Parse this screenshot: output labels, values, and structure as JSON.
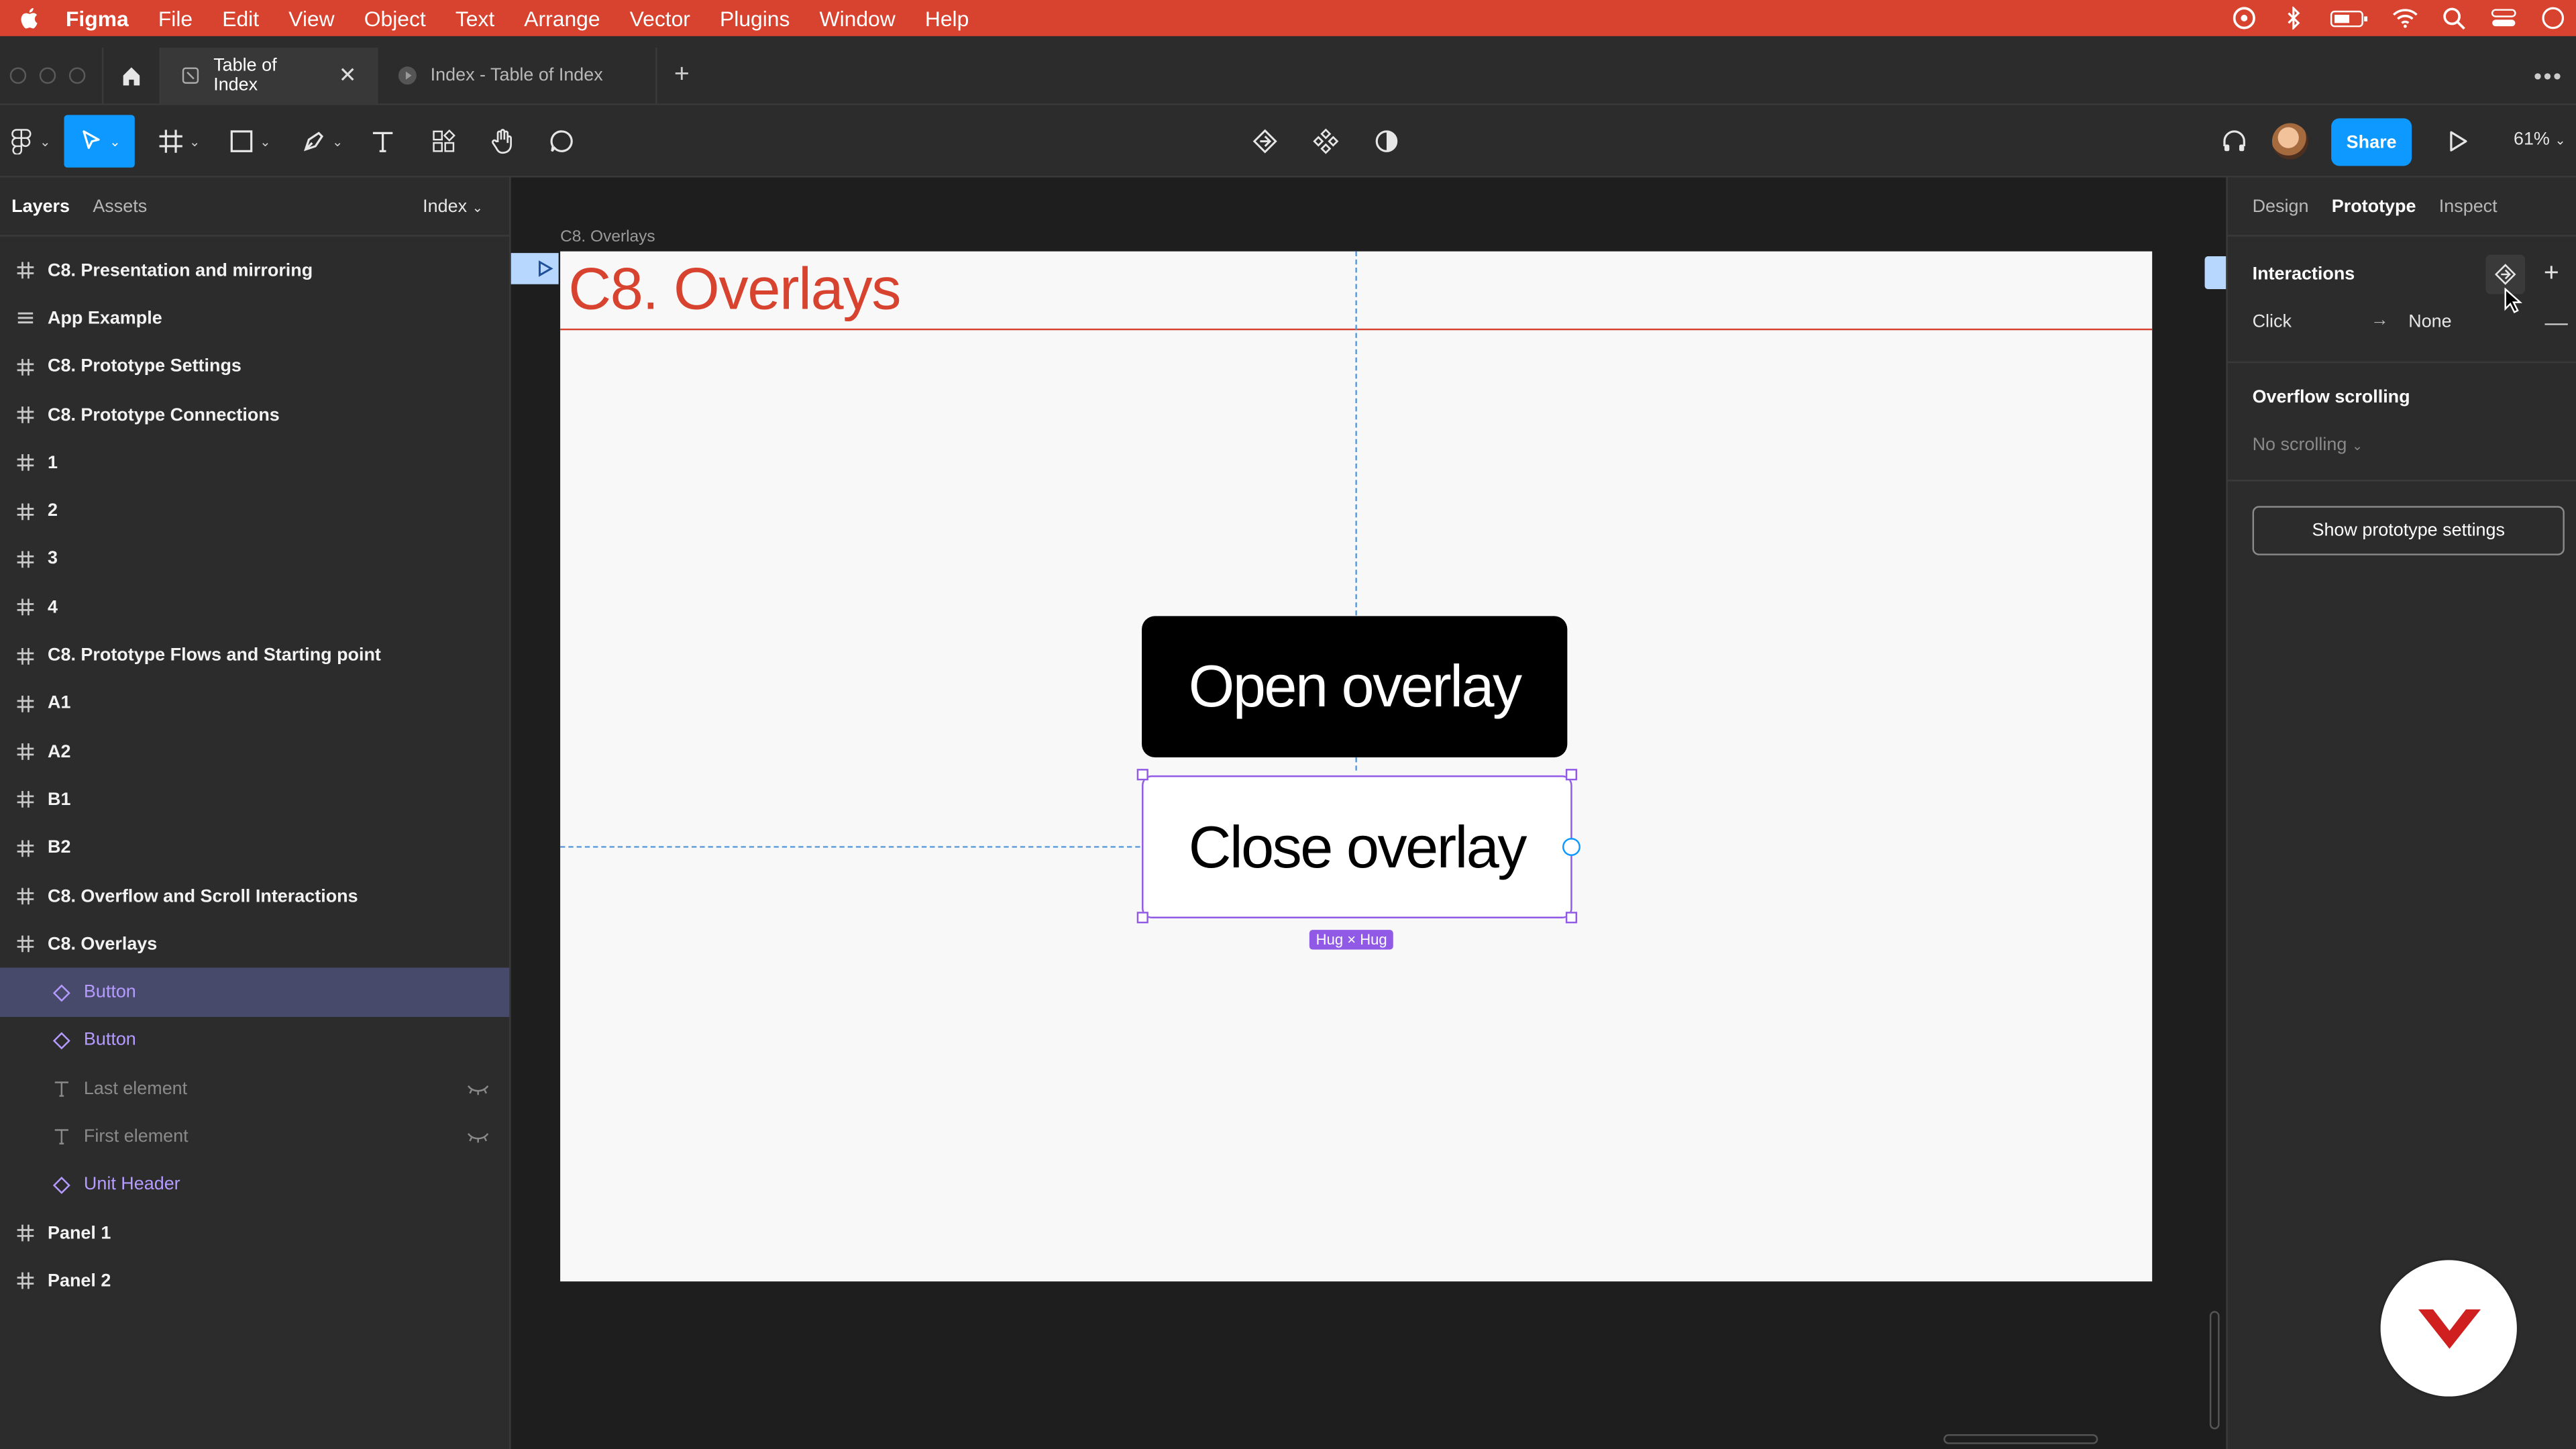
{
  "menubar": {
    "app": "Figma",
    "items": [
      "File",
      "Edit",
      "View",
      "Object",
      "Text",
      "Arrange",
      "Vector",
      "Plugins",
      "Window",
      "Help"
    ]
  },
  "tabs": {
    "active": "Table of Index",
    "inactive": "Index - Table of Index"
  },
  "toolbar": {
    "share_label": "Share",
    "zoom": "61%"
  },
  "left_panel": {
    "tab_layers": "Layers",
    "tab_assets": "Assets",
    "page_selector": "Index",
    "layers": [
      {
        "label": "C8. Presentation and mirroring",
        "kind": "frame"
      },
      {
        "label": "App Example",
        "kind": "list"
      },
      {
        "label": "C8. Prototype Settings",
        "kind": "frame"
      },
      {
        "label": "C8. Prototype Connections",
        "kind": "frame"
      },
      {
        "label": "1",
        "kind": "frame"
      },
      {
        "label": "2",
        "kind": "frame"
      },
      {
        "label": "3",
        "kind": "frame"
      },
      {
        "label": "4",
        "kind": "frame"
      },
      {
        "label": "C8. Prototype Flows and Starting point",
        "kind": "frame"
      },
      {
        "label": "A1",
        "kind": "frame"
      },
      {
        "label": "A2",
        "kind": "frame"
      },
      {
        "label": "B1",
        "kind": "frame"
      },
      {
        "label": "B2",
        "kind": "frame"
      },
      {
        "label": "C8. Overflow and Scroll Interactions",
        "kind": "frame"
      },
      {
        "label": "C8. Overlays",
        "kind": "frame"
      },
      {
        "label": "Button",
        "kind": "component-child",
        "selected": true
      },
      {
        "label": "Button",
        "kind": "component-child"
      },
      {
        "label": "Last element",
        "kind": "text-child",
        "hidden": true
      },
      {
        "label": "First element",
        "kind": "text-child",
        "hidden": true
      },
      {
        "label": "Unit Header",
        "kind": "component-child"
      },
      {
        "label": "Panel 1",
        "kind": "frame"
      },
      {
        "label": "Panel 2",
        "kind": "frame"
      }
    ]
  },
  "canvas": {
    "frame_label": "C8. Overlays",
    "frame_title": "C8.  Overlays",
    "open_button": "Open overlay",
    "close_button": "Close overlay",
    "size_badge": "Hug × Hug"
  },
  "right_panel": {
    "tabs": [
      "Design",
      "Prototype",
      "Inspect"
    ],
    "interactions_title": "Interactions",
    "interaction": {
      "trigger": "Click",
      "action": "None"
    },
    "overflow_title": "Overflow scrolling",
    "overflow_value": "No scrolling",
    "settings_button": "Show prototype settings"
  },
  "colors": {
    "accent": "#0d99ff",
    "brand_red": "#d8432f",
    "selection_purple": "#9059e6"
  }
}
